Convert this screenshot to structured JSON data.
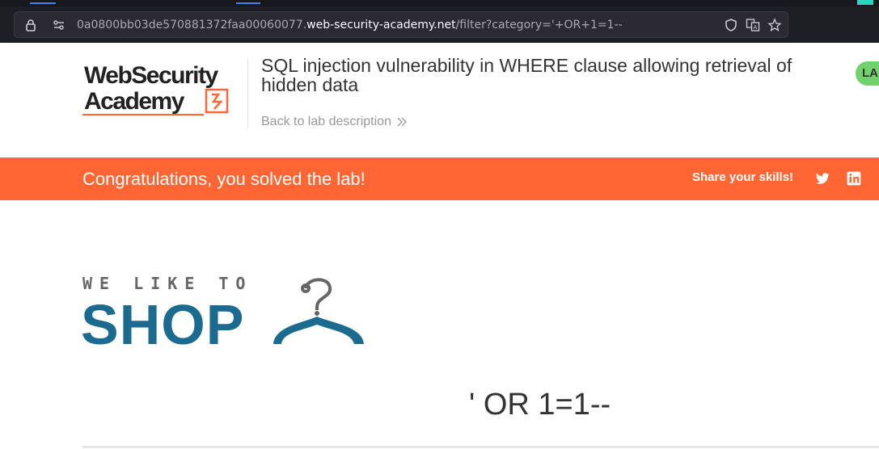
{
  "browser": {
    "url_host_prefix": "0a0800bb03de570881372faa00060077.",
    "url_host_domain": "web-security-academy.net",
    "url_path": "/filter?category='+OR+1=1--"
  },
  "lab": {
    "logo_line1": "WebSecurity",
    "logo_line2": "Academy",
    "title": "SQL injection vulnerability in WHERE clause allowing retrieval of hidden data",
    "back_link": "Back to lab description",
    "status_pill": "LA"
  },
  "banner": {
    "message": "Congratulations, you solved the lab!",
    "share_label": "Share your skills!"
  },
  "shop": {
    "tagline": "WE LIKE TO",
    "word": "SHOP",
    "category_heading": "' OR 1=1--"
  },
  "colors": {
    "banner": "#ff6633",
    "shop_blue": "#1a6b8f",
    "status_green": "#70d16d"
  }
}
